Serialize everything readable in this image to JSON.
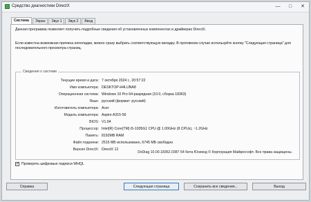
{
  "window": {
    "title": "Средство диагностики DirectX"
  },
  "tabs": [
    {
      "label": "Система"
    },
    {
      "label": "Экран"
    },
    {
      "label": "Звук 1"
    },
    {
      "label": "Звук 2"
    },
    {
      "label": "Ввод"
    }
  ],
  "intro": {
    "p1": "Данная программа позволяет получить подробные сведения об установленных компонентах и драйверах DirectX.",
    "p2": "Если известна возможная причина неполадки, можно сразу выбрать соответствующую вкладку. В противном случае используйте кнопку \"Следующая страница\" для последовательного просмотра страниц."
  },
  "system_info": {
    "group_title": "Сведения о системе",
    "rows": [
      {
        "label": "Текущие время и дата:",
        "value": "7 октября 2024 г., 20:57:22"
      },
      {
        "label": "Имя компьютера:",
        "value": "DESKTOP-H4LUNA8"
      },
      {
        "label": "Операционная система:",
        "value": "Windows 10 Pro 64-разрядная (10.0, сборка 18363)"
      },
      {
        "label": "Язык:",
        "value": "русский (формат: русский)"
      },
      {
        "label": "Изготовитель компьютера:",
        "value": "Acer"
      },
      {
        "label": "Модель компьютера:",
        "value": "Aspire A315-56"
      },
      {
        "label": "BIOS:",
        "value": "V1.04"
      },
      {
        "label": "Процессор:",
        "value": "Intel(R) Core(TM) i5-1035G1 CPU @ 1.00GHz (8 CPUs), ~1.2GHz"
      },
      {
        "label": "Память:",
        "value": "8192MB RAM"
      },
      {
        "label": "Файл подкачки:",
        "value": "2515 МБ использовано, 6745 МБ свободно"
      },
      {
        "label": "Версия DirectX:",
        "value": "DirectX 12"
      }
    ]
  },
  "whql": {
    "label": "Проверять цифровые подписи WHQL",
    "checked": true
  },
  "status": "DxDiag 10.00.18362.0387 64 бита Юникод © Корпорация Майкрософт. Все права защищены.",
  "buttons": {
    "help": "Справка",
    "next": "Следующая страница",
    "save": "Сохранить все сведения...",
    "exit": "Выход"
  }
}
